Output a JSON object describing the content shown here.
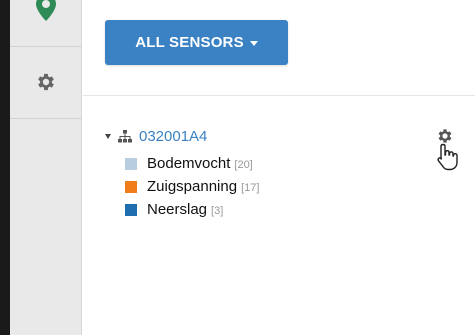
{
  "colors": {
    "accent": "#3a82c4",
    "sidebar_bg": "#e9e9e9",
    "sidebar_icon": "#666666",
    "top_icon": "#2e8b57"
  },
  "sidebar": {
    "items": [
      {
        "icon": "map-marker-icon"
      },
      {
        "icon": "gear-icon"
      }
    ]
  },
  "toolbar": {
    "all_sensors_label": "ALL SENSORS"
  },
  "tree": {
    "root": {
      "icon": "network-icon",
      "label": "032001A4",
      "settings_icon": "gear-icon"
    },
    "sensors": [
      {
        "name": "Bodemvocht",
        "count": "[20]",
        "color": "#b9cde0"
      },
      {
        "name": "Zuigspanning",
        "count": "[17]",
        "color": "#f07d1a"
      },
      {
        "name": "Neerslag",
        "count": "[3]",
        "color": "#1f6fb0"
      }
    ]
  }
}
